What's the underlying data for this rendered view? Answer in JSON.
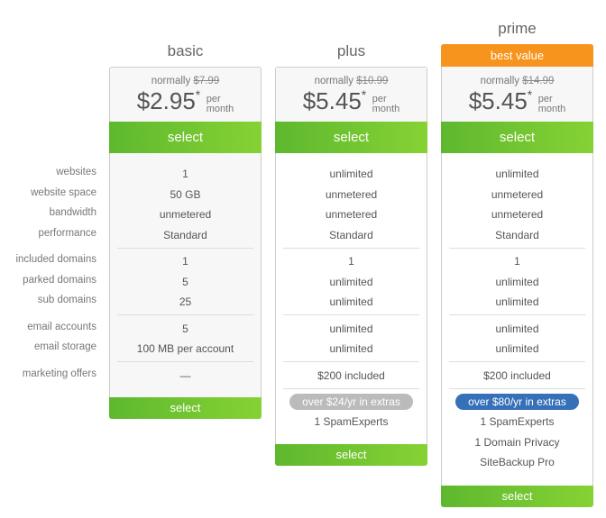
{
  "feature_labels": [
    "websites",
    "website space",
    "bandwidth",
    "performance",
    "included domains",
    "parked domains",
    "sub domains",
    "email accounts",
    "email storage",
    "marketing offers"
  ],
  "plans": [
    {
      "name": "basic",
      "normally_label": "normally",
      "old_price": "$7.99",
      "price": "$2.95",
      "asterisk": "*",
      "per": "per",
      "month": "month",
      "select_label": "select",
      "values": [
        "1",
        "50 GB",
        "unmetered",
        "Standard",
        "1",
        "5",
        "25",
        "5",
        "100 MB per account",
        "—"
      ],
      "bottom_select_label": "select"
    },
    {
      "name": "plus",
      "normally_label": "normally",
      "old_price": "$10.99",
      "price": "$5.45",
      "asterisk": "*",
      "per": "per",
      "month": "month",
      "select_label": "select",
      "values": [
        "unlimited",
        "unmetered",
        "unmetered",
        "Standard",
        "1",
        "unlimited",
        "unlimited",
        "unlimited",
        "unlimited",
        "$200 included"
      ],
      "extras_badge": "over $24/yr in extras",
      "extras_badge_color": "#bbbbbb",
      "extras": [
        "1 SpamExperts"
      ],
      "bottom_select_label": "select"
    },
    {
      "name": "prime",
      "top_badge": "best value",
      "top_badge_color": "#f7941d",
      "normally_label": "normally",
      "old_price": "$14.99",
      "price": "$5.45",
      "asterisk": "*",
      "per": "per",
      "month": "month",
      "select_label": "select",
      "values": [
        "unlimited",
        "unmetered",
        "unmetered",
        "Standard",
        "1",
        "unlimited",
        "unlimited",
        "unlimited",
        "unlimited",
        "$200 included"
      ],
      "extras_badge": "over $80/yr in extras",
      "extras_badge_color": "#3670b8",
      "extras": [
        "1 SpamExperts",
        "1 Domain Privacy",
        "SiteBackup Pro"
      ],
      "bottom_select_label": "select"
    }
  ],
  "colors": {
    "select_green_start": "#5eb82e",
    "select_green_end": "#86d234"
  }
}
